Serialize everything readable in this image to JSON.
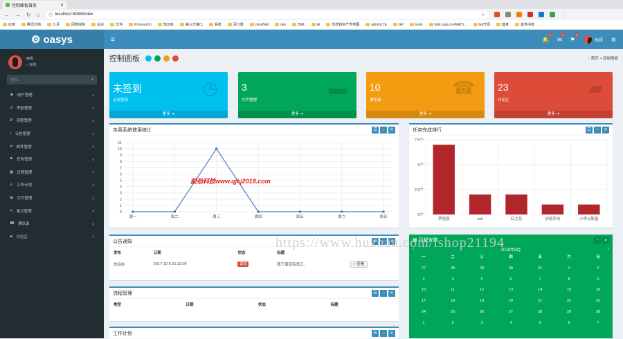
{
  "browser": {
    "tab_title": "控制面板首页",
    "url": "localhost:8088/index",
    "bookmarks": [
      "应用",
      "腾讯文档",
      "九月",
      "回想控制",
      "站点",
      "文件",
      "ProcessOn",
      "知识库",
      "第三方接口",
      "系统",
      "百分数",
      "niceWeb",
      "dev",
      "BML",
      "AI",
      "份样物资产界地图",
      "adminLTE",
      "GP",
      "tools",
      "felix.iuiqu.io:49487/...",
      "Git开源",
      "健身",
      "其他书签"
    ]
  },
  "app": {
    "logo": "oasys"
  },
  "header": {
    "badge_bell": "1",
    "badge_msg": "1",
    "badge_flag": "1",
    "username": "soli"
  },
  "sidebar": {
    "user_name": "soli",
    "status": "在线",
    "search_placeholder": "查找...",
    "items": [
      {
        "label": "用户管理",
        "icon": "user-icon"
      },
      {
        "label": "考勤管理",
        "icon": "clock-icon"
      },
      {
        "label": "流程管理",
        "icon": "flow-icon"
      },
      {
        "label": "公告管理",
        "icon": "bell-icon"
      },
      {
        "label": "邮件管理",
        "icon": "mail-icon"
      },
      {
        "label": "任务管理",
        "icon": "flag-icon"
      },
      {
        "label": "日程管理",
        "icon": "calendar-icon"
      },
      {
        "label": "工作计划",
        "icon": "plan-icon"
      },
      {
        "label": "文件管理",
        "icon": "folder-icon"
      },
      {
        "label": "笔记管理",
        "icon": "note-icon"
      },
      {
        "label": "通讯录",
        "icon": "phone-icon"
      },
      {
        "label": "讨论区",
        "icon": "chat-icon"
      }
    ]
  },
  "page": {
    "title": "控制面板",
    "crumb_home": "首页",
    "crumb_current": "控制面板"
  },
  "tiles": [
    {
      "value": "未签到",
      "label": "点击签到",
      "more": "更多",
      "color": "#00c0ef",
      "icon": "clock-icon"
    },
    {
      "value": "3",
      "label": "文件管理",
      "more": "更多",
      "color": "#00a65a",
      "icon": "folder-icon"
    },
    {
      "value": "10",
      "label": "通讯录",
      "more": "更多",
      "color": "#f39c12",
      "icon": "phone-icon"
    },
    {
      "value": "23",
      "label": "讨论区",
      "more": "更多",
      "color": "#dd4b39",
      "icon": "chat-icon"
    }
  ],
  "usage_chart": {
    "title": "本周系统使用统计",
    "chart_data": {
      "type": "line",
      "categories": [
        "周一",
        "周二",
        "周三",
        "周四",
        "周五",
        "周六",
        "周日"
      ],
      "values": [
        0,
        0,
        10,
        0,
        0,
        0,
        0
      ],
      "ylim": [
        0,
        11
      ],
      "yticks": [
        "0",
        "1",
        "2",
        "3",
        "4",
        "5",
        "6",
        "7",
        "8",
        "9",
        "10",
        "11"
      ]
    }
  },
  "task_chart": {
    "title": "任务完成排行",
    "chart_data": {
      "type": "bar",
      "categories": [
        "罗密欧",
        "soli",
        "红之花",
        "伊丽莎白",
        "小李父斯基"
      ],
      "values": [
        7.0,
        2.0,
        2.0,
        1.0,
        1.0
      ],
      "ylim": [
        0,
        7.5
      ],
      "yticks": [
        "0个",
        "2.5个",
        "5个",
        "7.5个"
      ]
    }
  },
  "notices": {
    "title": "公告通知",
    "columns": [
      "发布",
      "日期",
      "状态",
      "标题"
    ],
    "rows": [
      {
        "author": "总经办",
        "date": "2017-10-6 21:33:34",
        "status": "紧急",
        "title": "我下面没有员工,",
        "action": "查看"
      }
    ]
  },
  "process": {
    "title": "流程管理",
    "columns": [
      "类型",
      "日期",
      "状态",
      "标题"
    ]
  },
  "plan": {
    "title": "工作计划"
  },
  "calendar": {
    "title": "日程安排",
    "month": "2018年8月",
    "weekdays": [
      "一",
      "二",
      "三",
      "四",
      "五",
      "六",
      "日"
    ],
    "days": [
      "27",
      "28",
      "29",
      "30",
      "31",
      "1",
      "2",
      "3",
      "4",
      "5",
      "6",
      "7",
      "8",
      "9",
      "10",
      "11",
      "12",
      "13",
      "14",
      "15",
      "16",
      "17",
      "18",
      "19",
      "20",
      "21",
      "22",
      "23",
      "24",
      "25",
      "26",
      "27",
      "28",
      "29",
      "30",
      "1",
      "2",
      "3",
      "4",
      "5",
      "6",
      "7"
    ]
  },
  "watermark": "https://www.huzhan.com/ishop21194",
  "redmark": "前劲科技www.qjkj2018.com"
}
